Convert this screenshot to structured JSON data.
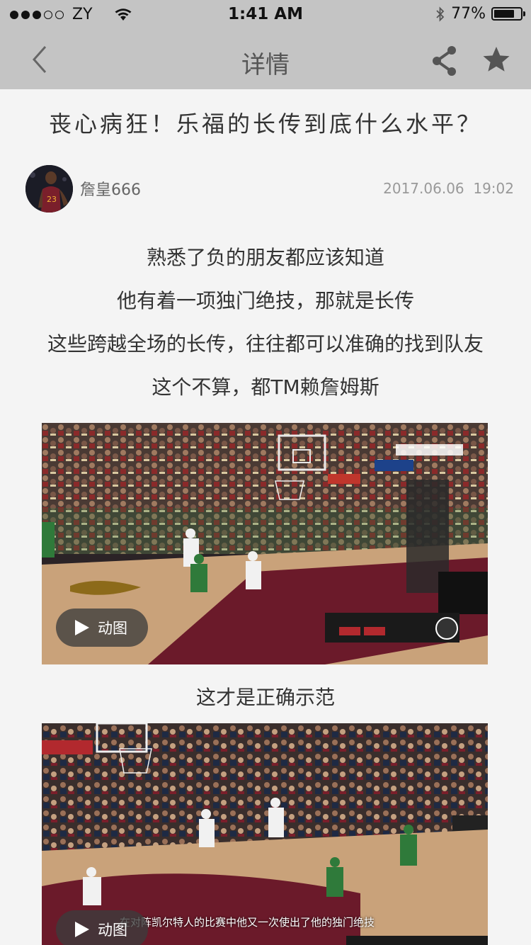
{
  "status_bar": {
    "carrier": "ZY",
    "time": "1:41 AM",
    "battery_text": "77%",
    "battery_level": 0.77,
    "signal_bars": 3,
    "signal_total": 5
  },
  "nav": {
    "title": "详情",
    "back_icon": "chevron-left-icon",
    "share_icon": "share-icon",
    "favorite_icon": "star-icon"
  },
  "article": {
    "title": "丧心病狂！乐福的长传到底什么水平？",
    "author": "詹皇666",
    "date": "2017.06.06",
    "time": "19:02",
    "paragraph_lines": [
      "熟悉了负的朋友都应该知道",
      "他有着一项独门绝技，那就是长传",
      "这些跨越全场的长传，往往都可以准确的找到队友",
      "这个不算，都TM赖詹姆斯"
    ],
    "caption": "这才是正确示范",
    "gif_label": "动图",
    "gif2_subtitle": "在对阵凯尔特人的比赛中他又一次使出了他的独门绝技"
  },
  "colors": {
    "header_bg": "#c4c4c4",
    "page_bg": "#f4f4f4",
    "court": "#c9a27a",
    "paint": "#6b1a2a"
  }
}
